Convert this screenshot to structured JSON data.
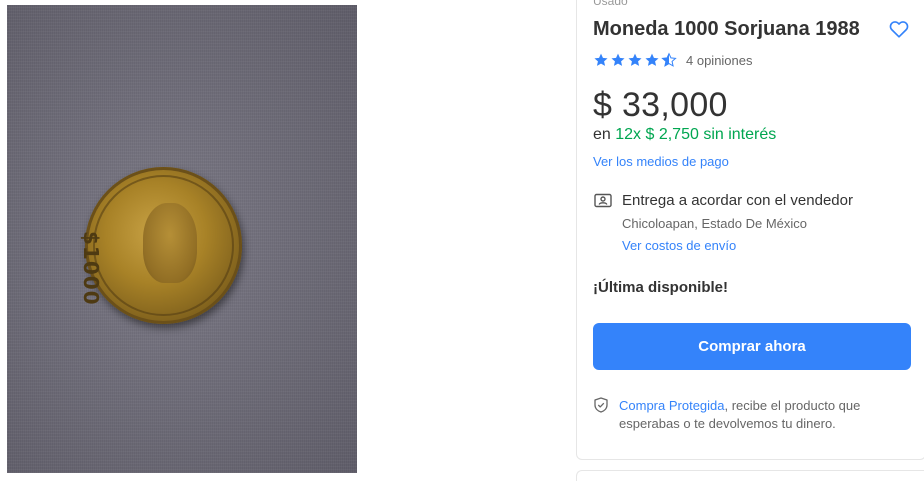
{
  "product": {
    "condition": "Usado",
    "title": "Moneda 1000 Sorjuana 1988",
    "coin_denomination": "$1000",
    "rating": {
      "stars": 4.5,
      "max_stars": 5,
      "reviews_label": "4 opiniones"
    },
    "price": "$ 33,000",
    "installments": {
      "prefix": "en",
      "plan": "12x $ 2,750 sin interés"
    },
    "payment_methods_link": "Ver los medios de pago",
    "delivery": {
      "title": "Entrega a acordar con el vendedor",
      "location": "Chicoloapan, Estado De México",
      "shipping_costs_link": "Ver costos de envío"
    },
    "stock_label": "¡Última disponible!",
    "buy_button_label": "Comprar ahora",
    "protection": {
      "link": "Compra Protegida",
      "text": ", recibe el producto que esperabas o te devolvemos tu dinero."
    }
  },
  "icons": {
    "favorite": "heart-icon",
    "delivery": "person-card-icon",
    "protection": "shield-check-icon",
    "star": "star-icon"
  },
  "colors": {
    "accent_blue": "#3483fa",
    "installment_green": "#00a650",
    "text_primary": "#333333",
    "text_secondary": "#666666"
  }
}
